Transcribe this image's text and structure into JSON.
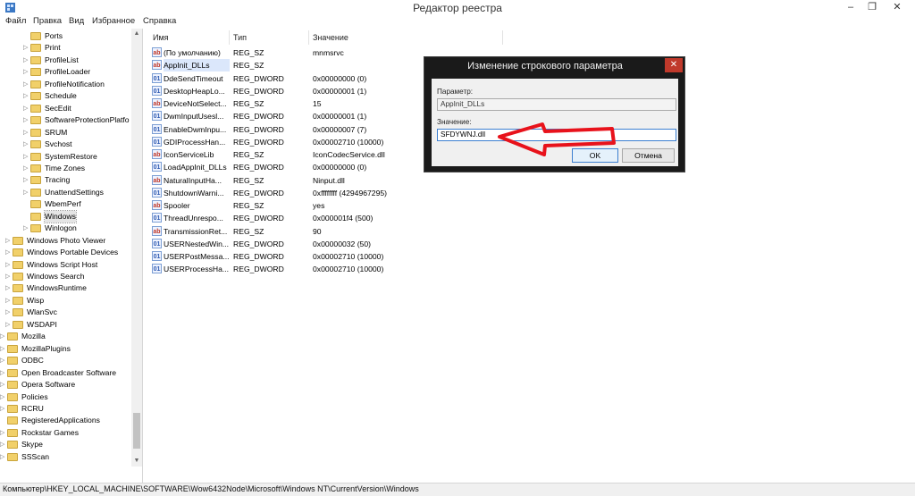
{
  "window": {
    "title": "Редактор реестра",
    "min": "–",
    "max": "❐",
    "close": "✕"
  },
  "menu": [
    "Файл",
    "Правка",
    "Вид",
    "Избранное",
    "Справка"
  ],
  "tree": {
    "items": [
      {
        "label": "Ports",
        "level": 2,
        "expander": "",
        "selected": false
      },
      {
        "label": "Print",
        "level": 2,
        "expander": "▷",
        "selected": false
      },
      {
        "label": "ProfileList",
        "level": 2,
        "expander": "▷",
        "selected": false
      },
      {
        "label": "ProfileLoader",
        "level": 2,
        "expander": "▷",
        "selected": false
      },
      {
        "label": "ProfileNotification",
        "level": 2,
        "expander": "▷",
        "selected": false
      },
      {
        "label": "Schedule",
        "level": 2,
        "expander": "▷",
        "selected": false
      },
      {
        "label": "SecEdit",
        "level": 2,
        "expander": "▷",
        "selected": false
      },
      {
        "label": "SoftwareProtectionPlatfo",
        "level": 2,
        "expander": "▷",
        "selected": false
      },
      {
        "label": "SRUM",
        "level": 2,
        "expander": "▷",
        "selected": false
      },
      {
        "label": "Svchost",
        "level": 2,
        "expander": "▷",
        "selected": false
      },
      {
        "label": "SystemRestore",
        "level": 2,
        "expander": "▷",
        "selected": false
      },
      {
        "label": "Time Zones",
        "level": 2,
        "expander": "▷",
        "selected": false
      },
      {
        "label": "Tracing",
        "level": 2,
        "expander": "▷",
        "selected": false
      },
      {
        "label": "UnattendSettings",
        "level": 2,
        "expander": "▷",
        "selected": false
      },
      {
        "label": "WbemPerf",
        "level": 2,
        "expander": "",
        "selected": false
      },
      {
        "label": "Windows",
        "level": 2,
        "expander": "",
        "selected": true
      },
      {
        "label": "Winlogon",
        "level": 2,
        "expander": "▷",
        "selected": false
      },
      {
        "label": "Windows Photo Viewer",
        "level": 1,
        "expander": "▷",
        "selected": false
      },
      {
        "label": "Windows Portable Devices",
        "level": 1,
        "expander": "▷",
        "selected": false
      },
      {
        "label": "Windows Script Host",
        "level": 1,
        "expander": "▷",
        "selected": false
      },
      {
        "label": "Windows Search",
        "level": 1,
        "expander": "▷",
        "selected": false
      },
      {
        "label": "WindowsRuntime",
        "level": 1,
        "expander": "▷",
        "selected": false
      },
      {
        "label": "Wisp",
        "level": 1,
        "expander": "▷",
        "selected": false
      },
      {
        "label": "WlanSvc",
        "level": 1,
        "expander": "▷",
        "selected": false
      },
      {
        "label": "WSDAPI",
        "level": 1,
        "expander": "▷",
        "selected": false
      },
      {
        "label": "Mozilla",
        "level": 0,
        "expander": "▷",
        "selected": false
      },
      {
        "label": "MozillaPlugins",
        "level": 0,
        "expander": "▷",
        "selected": false
      },
      {
        "label": "ODBC",
        "level": 0,
        "expander": "▷",
        "selected": false
      },
      {
        "label": "Open Broadcaster Software",
        "level": 0,
        "expander": "▷",
        "selected": false
      },
      {
        "label": "Opera Software",
        "level": 0,
        "expander": "▷",
        "selected": false
      },
      {
        "label": "Policies",
        "level": 0,
        "expander": "▷",
        "selected": false
      },
      {
        "label": "RCRU",
        "level": 0,
        "expander": "▷",
        "selected": false
      },
      {
        "label": "RegisteredApplications",
        "level": 0,
        "expander": "",
        "selected": false
      },
      {
        "label": "Rockstar Games",
        "level": 0,
        "expander": "▷",
        "selected": false
      },
      {
        "label": "Skype",
        "level": 0,
        "expander": "▷",
        "selected": false
      },
      {
        "label": "SSScan",
        "level": 0,
        "expander": "▷",
        "selected": false
      }
    ]
  },
  "values": {
    "headers": {
      "name": "Имя",
      "type": "Тип",
      "data": "Значение"
    },
    "rows": [
      {
        "name": "(По умолчанию)",
        "type": "REG_SZ",
        "data": "mnmsrvc",
        "kind": "sz",
        "selected": false
      },
      {
        "name": "AppInit_DLLs",
        "type": "REG_SZ",
        "data": "",
        "kind": "sz",
        "selected": true
      },
      {
        "name": "DdeSendTimeout",
        "type": "REG_DWORD",
        "data": "0x00000000 (0)",
        "kind": "dw",
        "selected": false
      },
      {
        "name": "DesktopHeapLo...",
        "type": "REG_DWORD",
        "data": "0x00000001 (1)",
        "kind": "dw",
        "selected": false
      },
      {
        "name": "DeviceNotSelect...",
        "type": "REG_SZ",
        "data": "15",
        "kind": "sz",
        "selected": false
      },
      {
        "name": "DwmInputUsesl...",
        "type": "REG_DWORD",
        "data": "0x00000001 (1)",
        "kind": "dw",
        "selected": false
      },
      {
        "name": "EnableDwmInpu...",
        "type": "REG_DWORD",
        "data": "0x00000007 (7)",
        "kind": "dw",
        "selected": false
      },
      {
        "name": "GDIProcessHan...",
        "type": "REG_DWORD",
        "data": "0x00002710 (10000)",
        "kind": "dw",
        "selected": false
      },
      {
        "name": "IconServiceLib",
        "type": "REG_SZ",
        "data": "IconCodecService.dll",
        "kind": "sz",
        "selected": false
      },
      {
        "name": "LoadAppInit_DLLs",
        "type": "REG_DWORD",
        "data": "0x00000000 (0)",
        "kind": "dw",
        "selected": false
      },
      {
        "name": "NaturalInputHa...",
        "type": "REG_SZ",
        "data": "Ninput.dll",
        "kind": "sz",
        "selected": false
      },
      {
        "name": "ShutdownWarni...",
        "type": "REG_DWORD",
        "data": "0xffffffff (4294967295)",
        "kind": "dw",
        "selected": false
      },
      {
        "name": "Spooler",
        "type": "REG_SZ",
        "data": "yes",
        "kind": "sz",
        "selected": false
      },
      {
        "name": "ThreadUnrespo...",
        "type": "REG_DWORD",
        "data": "0x000001f4 (500)",
        "kind": "dw",
        "selected": false
      },
      {
        "name": "TransmissionRet...",
        "type": "REG_SZ",
        "data": "90",
        "kind": "sz",
        "selected": false
      },
      {
        "name": "USERNestedWin...",
        "type": "REG_DWORD",
        "data": "0x00000032 (50)",
        "kind": "dw",
        "selected": false
      },
      {
        "name": "USERPostMessa...",
        "type": "REG_DWORD",
        "data": "0x00002710 (10000)",
        "kind": "dw",
        "selected": false
      },
      {
        "name": "USERProcessHa...",
        "type": "REG_DWORD",
        "data": "0x00002710 (10000)",
        "kind": "dw",
        "selected": false
      }
    ]
  },
  "dialog": {
    "title": "Изменение строкового параметра",
    "param_label": "Параметр:",
    "param_value": "AppInit_DLLs",
    "value_label": "Значение:",
    "value": "SFDYWNJ.dll",
    "ok": "OK",
    "cancel": "Отмена",
    "close": "✕"
  },
  "icons": {
    "sz": "ab",
    "dw": "01"
  },
  "annotation": {
    "arrow_color": "#e8121b"
  },
  "status": {
    "path": "Компьютер\\HKEY_LOCAL_MACHINE\\SOFTWARE\\Wow6432Node\\Microsoft\\Windows NT\\CurrentVersion\\Windows"
  }
}
